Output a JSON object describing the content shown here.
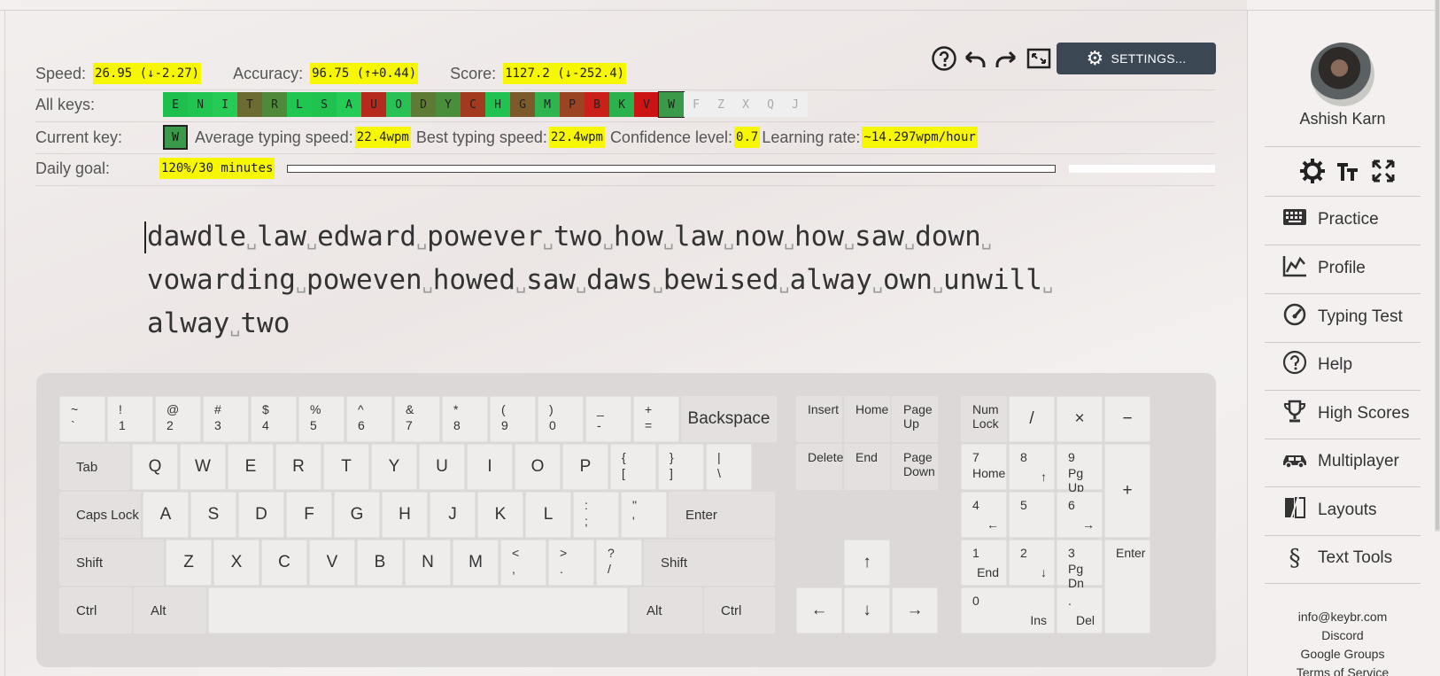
{
  "stats": {
    "speed_label": "Speed:",
    "speed_value": "26.95",
    "speed_delta": "(↓-2.27)",
    "accuracy_label": "Accuracy:",
    "accuracy_value": "96.75",
    "accuracy_delta": "(↑+0.44)",
    "score_label": "Score:",
    "score_value": "1127.2",
    "score_delta": "(↓-252.4)"
  },
  "toolbar": {
    "help_icon": "help-circle-icon",
    "undo_icon": "undo-icon",
    "redo_icon": "redo-icon",
    "fullscreen_icon": "fullscreen-icon",
    "settings_label": "SETTINGS..."
  },
  "all_keys": {
    "label": "All keys:",
    "keys": [
      {
        "k": "E",
        "color": "#1fbf4e"
      },
      {
        "k": "N",
        "color": "#21c551"
      },
      {
        "k": "I",
        "color": "#25cb55"
      },
      {
        "k": "T",
        "color": "#6b6b32"
      },
      {
        "k": "R",
        "color": "#4f8a3a"
      },
      {
        "k": "L",
        "color": "#20c650"
      },
      {
        "k": "S",
        "color": "#1fc14f"
      },
      {
        "k": "A",
        "color": "#24cc57"
      },
      {
        "k": "U",
        "color": "#b52a1c"
      },
      {
        "k": "O",
        "color": "#29c155"
      },
      {
        "k": "D",
        "color": "#5d7b35"
      },
      {
        "k": "Y",
        "color": "#4a8d3a"
      },
      {
        "k": "C",
        "color": "#a33a1f"
      },
      {
        "k": "H",
        "color": "#22c252"
      },
      {
        "k": "G",
        "color": "#7d5a2b"
      },
      {
        "k": "M",
        "color": "#2fb450"
      },
      {
        "k": "P",
        "color": "#9a4423"
      },
      {
        "k": "B",
        "color": "#c9201a"
      },
      {
        "k": "K",
        "color": "#2bb24e"
      },
      {
        "k": "V",
        "color": "#cc1414"
      },
      {
        "k": "W",
        "color": "#3a9a4a"
      },
      {
        "k": "F",
        "color": ""
      },
      {
        "k": "Z",
        "color": ""
      },
      {
        "k": "X",
        "color": ""
      },
      {
        "k": "Q",
        "color": ""
      },
      {
        "k": "J",
        "color": ""
      }
    ]
  },
  "current_key": {
    "label": "Current key:",
    "key": "W",
    "avg_label": "Average typing speed:",
    "avg_value": "22.4wpm",
    "best_label": "Best typing speed:",
    "best_value": "22.4wpm",
    "conf_label": "Confidence level:",
    "conf_value": "0.7",
    "rate_label": "Learning rate:",
    "rate_value": "~14.297wpm/hour"
  },
  "daily_goal": {
    "label": "Daily goal:",
    "value": "120%/30 minutes",
    "progress": 1.0
  },
  "typing_text": {
    "line1": [
      "dawdle",
      "law",
      "edward",
      "powever",
      "two",
      "how",
      "law",
      "now",
      "how",
      "saw",
      "down"
    ],
    "line2": [
      "vowarding",
      "poweven",
      "howed",
      "saw",
      "daws",
      "bewised",
      "alway",
      "own",
      "unwill"
    ],
    "line3": [
      "alway",
      "two"
    ]
  },
  "keyboard": {
    "row1": [
      [
        "~",
        "`"
      ],
      [
        "!",
        "1"
      ],
      [
        "@",
        "2"
      ],
      [
        "#",
        "3"
      ],
      [
        "$",
        "4"
      ],
      [
        "%",
        "5"
      ],
      [
        "^",
        "6"
      ],
      [
        "&",
        "7"
      ],
      [
        "*",
        "8"
      ],
      [
        "(",
        "9"
      ],
      [
        ")",
        "0"
      ],
      [
        "_",
        "-"
      ],
      [
        "+",
        "="
      ]
    ],
    "backspace": "Backspace",
    "tab": "Tab",
    "row2": [
      "Q",
      "W",
      "E",
      "R",
      "T",
      "Y",
      "U",
      "I",
      "O",
      "P"
    ],
    "row2_sym": [
      [
        "{",
        "["
      ],
      [
        "}",
        "]"
      ],
      [
        "|",
        "\\"
      ]
    ],
    "caps": "Caps Lock",
    "row3": [
      "A",
      "S",
      "D",
      "F",
      "G",
      "H",
      "J",
      "K",
      "L"
    ],
    "row3_sym": [
      [
        ":",
        ";"
      ],
      [
        "\"",
        "'"
      ]
    ],
    "enter": "Enter",
    "shift": "Shift",
    "row4": [
      "Z",
      "X",
      "C",
      "V",
      "B",
      "N",
      "M"
    ],
    "row4_sym": [
      [
        "<",
        ","
      ],
      [
        ">",
        "."
      ],
      [
        "?",
        "/"
      ]
    ],
    "ctrl": "Ctrl",
    "alt": "Alt",
    "nav": {
      "insert": "Insert",
      "home": "Home",
      "pageup": "Page Up",
      "delete": "Delete",
      "end": "End",
      "pagedown": "Page Down"
    },
    "arrows": {
      "up": "↑",
      "down": "↓",
      "left": "←",
      "right": "→"
    },
    "numpad": {
      "numlock": "Num Lock",
      "div": "/",
      "mul": "×",
      "minus": "−",
      "plus": "+",
      "n7": "7",
      "n7b": "Home",
      "n8": "8",
      "n8b": "↑",
      "n9": "9",
      "n9b": "Pg Up",
      "n4": "4",
      "n4b": "←",
      "n5": "5",
      "n6": "6",
      "n6b": "→",
      "n1": "1",
      "n1b": "End",
      "n2": "2",
      "n2b": "↓",
      "n3": "3",
      "n3b": "Pg Dn",
      "enter": "Enter",
      "n0": "0",
      "n0b": "Ins",
      "dot": ".",
      "dotb": "Del"
    }
  },
  "sidebar": {
    "username": "Ashish Karn",
    "nav": [
      {
        "label": "Practice",
        "icon": "keyboard-icon"
      },
      {
        "label": "Profile",
        "icon": "chart-icon"
      },
      {
        "label": "Typing Test",
        "icon": "gauge-icon"
      },
      {
        "label": "Help",
        "icon": "help-icon"
      },
      {
        "label": "High Scores",
        "icon": "trophy-icon"
      },
      {
        "label": "Multiplayer",
        "icon": "car-icon"
      },
      {
        "label": "Layouts",
        "icon": "layouts-icon"
      },
      {
        "label": "Text Tools",
        "icon": "section-icon"
      }
    ],
    "links": [
      "info@keybr.com",
      "Discord",
      "Google Groups",
      "Terms of Service"
    ]
  }
}
